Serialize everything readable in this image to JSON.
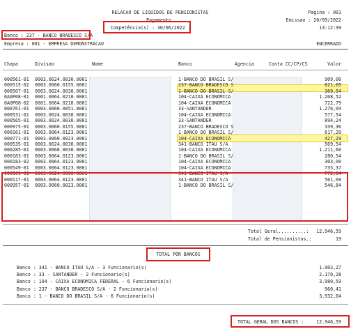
{
  "header": {
    "title": "RELACAO DE LIQUIDOS DE PENSIONISTAS",
    "subtitle": "Pagamento.",
    "competencia": "Competência(s) : 30/06/2022 .",
    "pagina": "Pagina : 001",
    "emissao": "Emissao : 20/09/2022",
    "hora": "13:12:39"
  },
  "filters": {
    "banco": "Banco : 237 - BANCO BRADESCO S/A",
    "empresa": "Empresa : 001 - EMPRESA DEMONSTRACAO",
    "status": "ENCERRADO"
  },
  "columns": {
    "chapa": "Chapa",
    "divisao": "Divisao",
    "nome": "Nome",
    "banco": "Banco",
    "agencia": "Agencia",
    "conta": "Conta CC/CP/CS",
    "valor": "Valor"
  },
  "rows": [
    {
      "chapa": "000561-01",
      "divisao": "0003.0024.0030.0001",
      "banco": "1-BANCO DO BRASIL S/",
      "valor": "909,00"
    },
    {
      "chapa": "000515-02",
      "divisao": "0003.0060.0155.0001",
      "banco": "237-BANCO BRADESCO S",
      "valor": "621,05"
    },
    {
      "chapa": "000507-01",
      "divisao": "0003.0024.0030.0001",
      "banco": "1-BANCO DO BRASIL S/",
      "valor": "369,54"
    },
    {
      "chapa": "0A0P08-01",
      "divisao": "0001.0064.0210.0001",
      "banco": "104-CAIXA ECONOMICA",
      "valor": "1.208,52"
    },
    {
      "chapa": "0A0P08-02",
      "divisao": "0001.0064.0210.0001",
      "banco": "104-CAIXA ECONOMICA",
      "valor": "722,79"
    },
    {
      "chapa": "000761-01",
      "divisao": "0003.0060.0051.0001",
      "banco": "33-SANTANDER",
      "valor": "1.276,04"
    },
    {
      "chapa": "000531-01",
      "divisao": "0003.0024.0030.0001",
      "banco": "104-CAIXA ECONOMICA",
      "valor": "577,54"
    },
    {
      "chapa": "000565-01",
      "divisao": "0003.0024.0030.0001",
      "banco": "33-SANTANDER",
      "valor": "894,24"
    },
    {
      "chapa": "000975-01",
      "divisao": "0003.0060.0155.0001",
      "banco": "237-BANCO BRADESCO S",
      "valor": "339,36"
    },
    {
      "chapa": "000161-01",
      "divisao": "0003.0064.0123.0001",
      "banco": "1-BANCO DO BRASIL S/",
      "valor": "617,20"
    },
    {
      "chapa": "000771-01",
      "divisao": "0003.0060.0023.0001",
      "banco": "104-CAIXA ECONOMICA",
      "valor": "427,29"
    },
    {
      "chapa": "000535-01",
      "divisao": "0003.0024.0030.0001",
      "banco": "341-BANCO ITAU S/A",
      "valor": "569,54"
    },
    {
      "chapa": "000285-01",
      "divisao": "0003.0060.0030.0001",
      "banco": "104-CAIXA ECONOMICA",
      "valor": "1.211,60"
    },
    {
      "chapa": "000183-01",
      "divisao": "0003.0064.0123.0001",
      "banco": "1-BANCO DO BRASIL S/",
      "valor": "280,54"
    },
    {
      "chapa": "000183-02",
      "divisao": "0003.0064.0123.0001",
      "banco": "104-CAIXA ECONOMICA",
      "valor": "303,00"
    },
    {
      "chapa": "000549-01",
      "divisao": "0003.0064.0123.0001",
      "banco": "104-CAIXA ECONOMICA",
      "valor": "735,37"
    },
    {
      "chapa": "000509-01",
      "divisao": "0003.0024.0030.0001",
      "banco": "341-BANCO ITAU S/A",
      "valor": "772,64"
    },
    {
      "chapa": "000117-01",
      "divisao": "0003.0064.0123.0001",
      "banco": "341-BANCO ITAU S/A",
      "valor": "561,09"
    },
    {
      "chapa": "000957-01",
      "divisao": "0003.0060.0023.0001",
      "banco": "1-BANCO DO BRASIL S/",
      "valor": "546,84"
    }
  ],
  "totals": {
    "total_geral_label": "Total Geral..........:",
    "total_geral_value": "12.946,59",
    "total_pens_label": "Total de Pensionistas.:",
    "total_pens_value": "19"
  },
  "bank_summary_title": "TOTAL  POR  BANCOS",
  "bank_summary": [
    {
      "label": "Banco : 341 - BANCO ITAU S/A - 3 Funcionario(s)",
      "value": "1.903,27"
    },
    {
      "label": "Banco : 33 - SANTANDER - 2 Funcionario(s)",
      "value": "2.170,28"
    },
    {
      "label": "Banco : 104 - CAIXA ECONOMICA FEDERAL - 6 Funcionario(s)",
      "value": "3.980,59"
    },
    {
      "label": "Banco : 237 - BANCO BRADESCO S/A - 2 Funcionario(s)",
      "value": "960,41"
    },
    {
      "label": "Banco : 1 - BANCO DO BRASIL S/A - 6 Funcionario(s)",
      "value": "3.932,04"
    }
  ],
  "grand_total": {
    "label": "TOTAL GERAL DOS BANCOS :",
    "value": "12.946,59"
  },
  "colors": {
    "highlight_border": "#d42020",
    "highlight_fill": "#fff7a0"
  }
}
